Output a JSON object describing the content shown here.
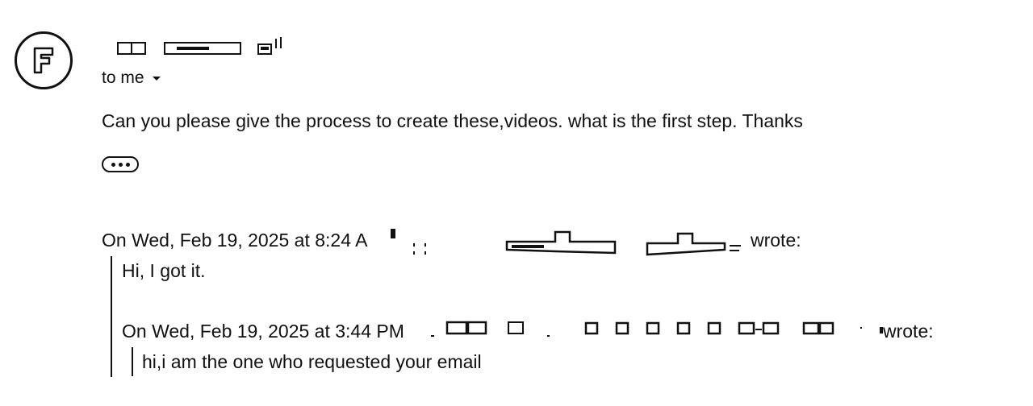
{
  "sender": {
    "avatar_letter": "F",
    "recipient_label": "to me"
  },
  "message": {
    "body": "Can you please give the process to create these,videos. what is the first step. Thanks",
    "more_label": "•••"
  },
  "quote1": {
    "header": "On Wed, Feb 19, 2025 at 8:24 A",
    "wrote": "wrote:",
    "text": "Hi, I got it."
  },
  "quote2": {
    "header": "On Wed, Feb 19, 2025 at 3:44 PM",
    "wrote": "wrote:",
    "text": "hi,i am the one who requested your email"
  },
  "icons": {
    "avatar": "letter-f-avatar-icon",
    "recipient_dropdown": "chevron-down-icon",
    "show_trimmed": "more-horizontal-icon"
  }
}
